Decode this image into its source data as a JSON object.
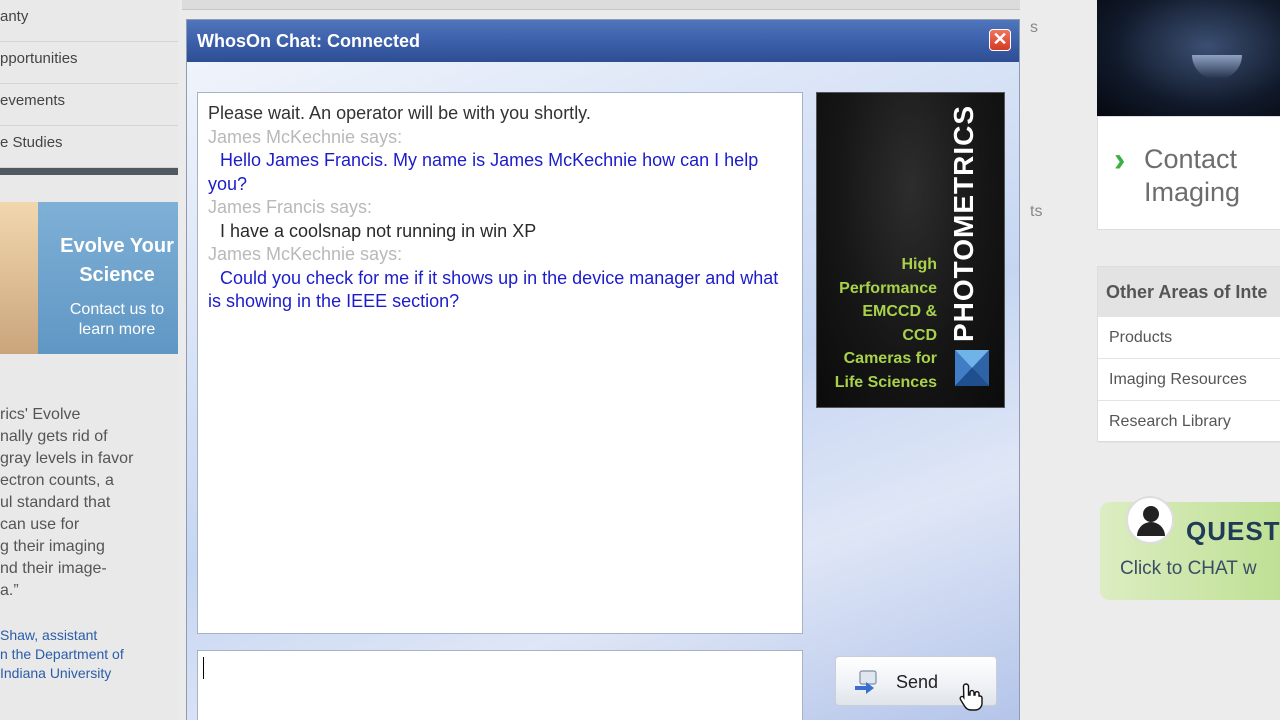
{
  "background_site": {
    "left_nav": [
      "anty",
      "pportunities",
      "evements",
      "e Studies"
    ],
    "promo": {
      "title": "Evolve Your Science",
      "subtitle": "Contact us to learn more"
    },
    "quote_lines": [
      "rics' Evolve",
      "nally gets rid of",
      "gray levels in favor",
      "ectron counts, a",
      "ul standard that",
      "can use for",
      "g their imaging",
      "nd their image-",
      "a.”"
    ],
    "attribution_lines": [
      "Shaw, assistant",
      "n the Department of",
      "Indiana University"
    ],
    "mid_fragments": [
      "s",
      "ts"
    ],
    "contact": {
      "line1": "Contact",
      "line2": "Imaging"
    },
    "other_areas": {
      "heading": "Other Areas of Inte",
      "links": [
        "Products",
        "Imaging Resources",
        "Research Library"
      ]
    },
    "question_widget": {
      "title": "QUEST",
      "subtitle": "Click to CHAT w"
    }
  },
  "chat": {
    "title": "WhosOn Chat: Connected",
    "close_symbol": "✕",
    "transcript": [
      {
        "kind": "system",
        "text": "Please wait. An operator will be with you shortly."
      },
      {
        "kind": "speaker",
        "text": "James McKechnie says:"
      },
      {
        "kind": "operator",
        "text": "Hello James Francis. My name is James McKechnie how can I help you?"
      },
      {
        "kind": "speaker",
        "text": "James Francis says:"
      },
      {
        "kind": "visitor",
        "text": "I have a coolsnap not running in win XP"
      },
      {
        "kind": "speaker",
        "text": "James McKechnie says:"
      },
      {
        "kind": "operator",
        "text": "Could you check for me if it shows up in the device manager and what is showing in the IEEE section?"
      }
    ],
    "ad": {
      "brand": "PHOTOMETRICS",
      "tagline_lines": [
        "High",
        "Performance",
        "EMCCD &",
        "CCD",
        "Cameras for",
        "Life Sciences"
      ]
    },
    "input_value": "",
    "send_label": "Send"
  },
  "colors": {
    "titlebar": "#3b5ea8",
    "operator_text": "#1c1ccc",
    "speaker_text": "#b9b9b9",
    "close_button": "#d43a22",
    "ad_accent": "#a8d24a"
  },
  "icons": [
    "close-icon",
    "send-icon",
    "mouse-pointer-icon",
    "chevron-right-icon",
    "user-avatar-icon"
  ]
}
